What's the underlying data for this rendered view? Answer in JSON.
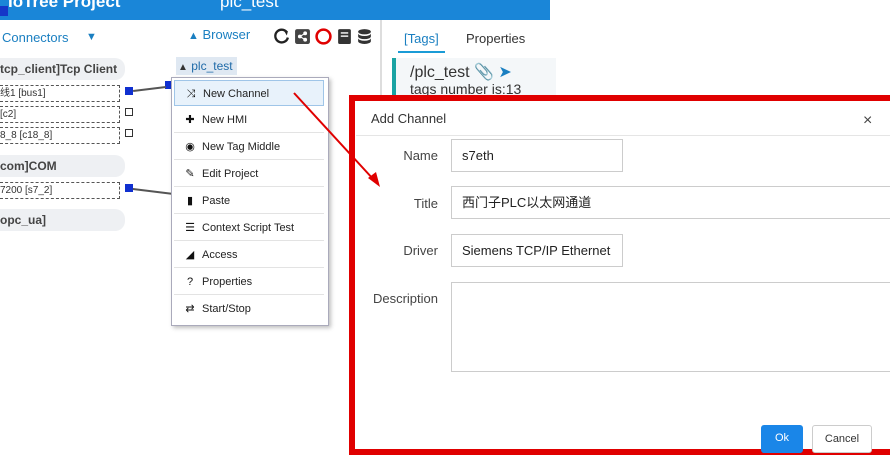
{
  "title_bar": {
    "project_name": "IoTree Project",
    "subtitle": "plc_test"
  },
  "connectors": {
    "tab_label": "Connectors",
    "caret": "▼",
    "items": [
      {
        "label": "tcp_client]Tcp Client",
        "subs": [
          "线1 [bus1]",
          "[c2]",
          "8_8 [c18_8]"
        ]
      },
      {
        "label": "com]COM",
        "subs": [
          "7200 [s7_2]"
        ]
      },
      {
        "label": "opc_ua]",
        "subs": []
      }
    ]
  },
  "browser": {
    "label": "Browser",
    "icon": "sitemap-icon"
  },
  "toolbar_icons": [
    "refresh-icon",
    "share-icon",
    "stop-circle-icon",
    "book-icon",
    "database-icon"
  ],
  "canvas": {
    "node_label": "plc_test"
  },
  "context_menu": {
    "items": [
      {
        "label": "New Channel",
        "icon": "shuffle-icon",
        "glyph": "⤨",
        "active": true
      },
      {
        "label": "New HMI",
        "icon": "puzzle-icon",
        "glyph": "✚"
      },
      {
        "label": "New Tag Middle",
        "icon": "compass-icon",
        "glyph": "◉"
      },
      {
        "label": "Edit Project",
        "icon": "pencil-icon",
        "glyph": "✎"
      },
      {
        "label": "Paste",
        "icon": "clipboard-icon",
        "glyph": "▮"
      },
      {
        "label": "Context Script Test",
        "icon": "list-icon",
        "glyph": "☰"
      },
      {
        "label": "Access",
        "icon": "signal-icon",
        "glyph": "◢"
      },
      {
        "label": "Properties",
        "icon": "question-icon",
        "glyph": "?"
      },
      {
        "label": "Start/Stop",
        "icon": "sync-icon",
        "glyph": "⇄"
      }
    ]
  },
  "right_panel": {
    "tabs": [
      "[Tags]",
      "Properties"
    ],
    "path": "/plc_test",
    "tags_number": "tags number is:13"
  },
  "modal": {
    "title": "Add Channel",
    "close": "×",
    "fields": {
      "name_label": "Name",
      "name_value": "s7eth",
      "title_label": "Title",
      "title_value": "西门子PLC以太网通道",
      "driver_label": "Driver",
      "driver_value": "Siemens TCP/IP Ethernet",
      "description_label": "Description",
      "description_value": ""
    },
    "ok_label": "Ok",
    "cancel_label": "Cancel"
  },
  "colors": {
    "title_bar": "#1a86d8",
    "accent": "#1a7fc1",
    "highlight_frame": "#e00000",
    "port": "#1030d0",
    "ok_button": "#1a86e8"
  }
}
